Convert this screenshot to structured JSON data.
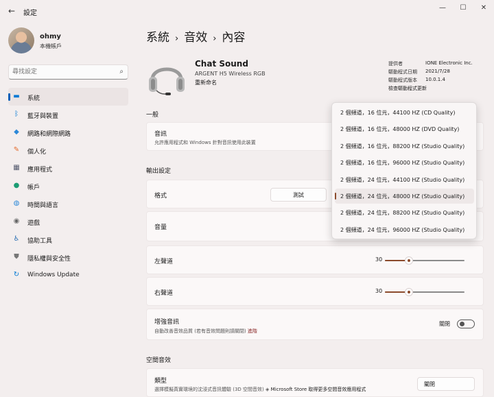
{
  "window": {
    "back_glyph": "←",
    "title": "設定",
    "min_glyph": "—",
    "max_glyph": "☐",
    "close_glyph": "✕"
  },
  "profile": {
    "name": "ohmy",
    "type": "本機帳戶"
  },
  "search": {
    "placeholder": "尋找設定",
    "icon_glyph": "⌕"
  },
  "nav": {
    "items": [
      {
        "label": "系統",
        "icon": "monitor-icon",
        "glyph": "▬",
        "color": "#0078d4"
      },
      {
        "label": "藍牙與裝置",
        "icon": "bluetooth-icon",
        "glyph": "ᛒ",
        "color": "#0078d4"
      },
      {
        "label": "網路和網際網路",
        "icon": "wifi-icon",
        "glyph": "◆",
        "color": "#2b88d8"
      },
      {
        "label": "個人化",
        "icon": "brush-icon",
        "glyph": "✎",
        "color": "#e36a2b"
      },
      {
        "label": "應用程式",
        "icon": "apps-icon",
        "glyph": "▦",
        "color": "#555a6e"
      },
      {
        "label": "帳戶",
        "icon": "person-icon",
        "glyph": "●",
        "color": "#1c9c73"
      },
      {
        "label": "時間與語言",
        "icon": "globe-icon",
        "glyph": "◍",
        "color": "#2b88d8"
      },
      {
        "label": "遊戲",
        "icon": "gamepad-icon",
        "glyph": "◉",
        "color": "#666666"
      },
      {
        "label": "協助工具",
        "icon": "accessibility-icon",
        "glyph": "♿",
        "color": "#2b6fb3"
      },
      {
        "label": "隱私權與安全性",
        "icon": "shield-icon",
        "glyph": "⛊",
        "color": "#777777"
      },
      {
        "label": "Windows Update",
        "icon": "update-icon",
        "glyph": "↻",
        "color": "#0078d4"
      }
    ]
  },
  "breadcrumb": {
    "part1": "系統",
    "part2": "音效",
    "current": "內容",
    "sep": "›"
  },
  "device": {
    "name": "Chat Sound",
    "model": "ARGENT H5 Wireless RGB",
    "rename": "重新命名",
    "info": [
      {
        "k": "提供者",
        "v": "IONE Electronic Inc."
      },
      {
        "k": "驅動程式日期",
        "v": "2021/7/28"
      },
      {
        "k": "驅動程式版本",
        "v": "10.0.1.4"
      }
    ],
    "update_link": "檢查驅動程式更新"
  },
  "general": {
    "heading": "一般",
    "audio_title": "音訊",
    "audio_desc": "允許應用程式和 Windows 針對音訊使用此裝置"
  },
  "output": {
    "heading": "輸出設定",
    "format_label": "格式",
    "test_button": "測試",
    "volume_label": "音量",
    "left_label": "左聲道",
    "left_value": 30,
    "right_label": "右聲道",
    "right_value": 30,
    "enhance_title": "增強音訊",
    "enhance_desc": "自動改善音效品質 (若有音效問題則請關閉)",
    "enhance_link": "進階",
    "enhance_state": "關閉"
  },
  "spatial": {
    "heading": "空間音效",
    "type_label": "類型",
    "type_desc": "選擇模擬真實環境的沈浸式音訊體驗 (3D 空間音效)",
    "store_glyph": "◈",
    "store_link": "Microsoft Store 取得更多空間音效應用程式",
    "type_value": "關閉",
    "chevron": "⌄"
  },
  "format_dropdown": {
    "options": [
      "2 個頻道，16 位元，44100 HZ (CD Quality)",
      "2 個頻道，16 位元，48000 HZ (DVD Quality)",
      "2 個頻道，16 位元，88200 HZ (Studio Quality)",
      "2 個頻道，16 位元，96000 HZ (Studio Quality)",
      "2 個頻道，24 位元，44100 HZ (Studio Quality)",
      "2 個頻道，24 位元，48000 HZ (Studio Quality)",
      "2 個頻道，24 位元，88200 HZ (Studio Quality)",
      "2 個頻道，24 位元，96000 HZ (Studio Quality)"
    ],
    "selected_index": 5
  },
  "colors": {
    "accent": "#8b4a2b",
    "nav_accent": "#005fb8",
    "background": "#f3eeee"
  }
}
